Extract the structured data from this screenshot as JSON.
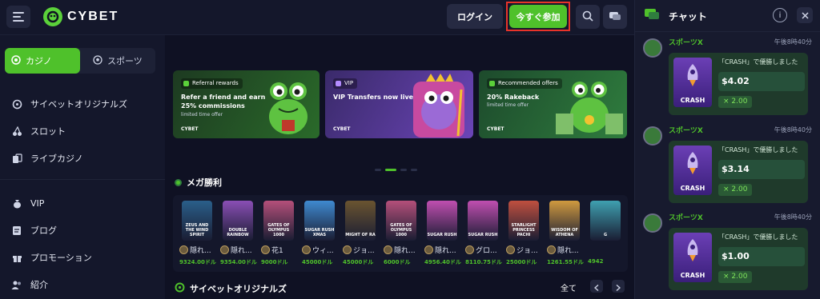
{
  "header": {
    "logo_text": "CYBET",
    "login_label": "ログイン",
    "join_label": "今すぐ参加",
    "highlight_color": "#e8332a",
    "accent_color": "#4fc12b"
  },
  "sidebar": {
    "tabs": [
      {
        "label": "カジノ",
        "icon": "casino-chip-icon",
        "active": true
      },
      {
        "label": "スポーツ",
        "icon": "soccer-ball-icon",
        "active": false
      }
    ],
    "items": [
      {
        "label": "サイベットオリジナルズ",
        "icon": "gamepad-icon"
      },
      {
        "label": "スロット",
        "icon": "cherries-icon"
      },
      {
        "label": "ライブカジノ",
        "icon": "cards-icon"
      },
      {
        "label": "VIP",
        "icon": "money-bag-icon"
      },
      {
        "label": "ブログ",
        "icon": "document-icon"
      },
      {
        "label": "プロモーション",
        "icon": "gift-icon"
      },
      {
        "label": "紹介",
        "icon": "users-icon"
      }
    ]
  },
  "banners": [
    {
      "tag": "Referral rewards",
      "title": "Refer a friend and earn 25% commissions",
      "subtitle": "limited time offer",
      "brand": "CYBET"
    },
    {
      "tag": "VIP",
      "title": "VIP Transfers now live",
      "subtitle": "",
      "brand": "CYBET"
    },
    {
      "tag": "Recommended offers",
      "title": "20% Rakeback",
      "subtitle": "limited time offer",
      "brand": "CYBET"
    }
  ],
  "mega_wins": {
    "title": "メガ勝利",
    "games": [
      {
        "name": "ZEUS AND THE WIND SPIRIT",
        "user": "隠れ...",
        "amount": "9324.00ドル",
        "color": "#2a5f8a"
      },
      {
        "name": "DOUBLE RAINBOW",
        "user": "隠れ...",
        "amount": "9354.00ドル",
        "color": "#8a4fb5"
      },
      {
        "name": "GATES OF OLYMPUS 1000",
        "user": "花1",
        "amount": "9000ドル",
        "color": "#b5507a"
      },
      {
        "name": "SUGAR RUSH XMAS",
        "user": "ウィ...",
        "amount": "45000ドル",
        "color": "#3f8ad0"
      },
      {
        "name": "MIGHT OF RA",
        "user": "ジョ...",
        "amount": "45000ドル",
        "color": "#6a5430"
      },
      {
        "name": "GATES OF OLYMPUS 1000",
        "user": "隠れ...",
        "amount": "6000ドル",
        "color": "#b5507a"
      },
      {
        "name": "SUGAR RUSH",
        "user": "隠れ...",
        "amount": "4956.40ドル",
        "color": "#c04fb0"
      },
      {
        "name": "SUGAR RUSH",
        "user": "グロ...",
        "amount": "8110.75ドル",
        "color": "#c04fb0"
      },
      {
        "name": "STARLIGHT PRINCESS PACHI",
        "user": "ジョ...",
        "amount": "25000ドル",
        "color": "#c0503f"
      },
      {
        "name": "WISDOM OF ATHENA",
        "user": "隠れ...",
        "amount": "1261.55ドル",
        "color": "#d09a3f"
      },
      {
        "name": "G",
        "user": "",
        "amount": "4942",
        "color": "#3fa0b0"
      }
    ]
  },
  "originals": {
    "title": "サイベットオリジナルズ",
    "all_label": "全て"
  },
  "chat": {
    "title": "チャット",
    "messages": [
      {
        "user": "スポーツX",
        "time": "午後8時40分",
        "text": "「CRASH」で優勝しました",
        "game": "CRASH",
        "amount": "$4.02",
        "multiplier": "× 2.00"
      },
      {
        "user": "スポーツX",
        "time": "午後8時40分",
        "text": "「CRASH」で優勝しました",
        "game": "CRASH",
        "amount": "$3.14",
        "multiplier": "× 2.00"
      },
      {
        "user": "スポーツX",
        "time": "午後8時40分",
        "text": "「CRASH」で優勝しました",
        "game": "CRASH",
        "amount": "$1.00",
        "multiplier": "× 2.00"
      }
    ]
  }
}
